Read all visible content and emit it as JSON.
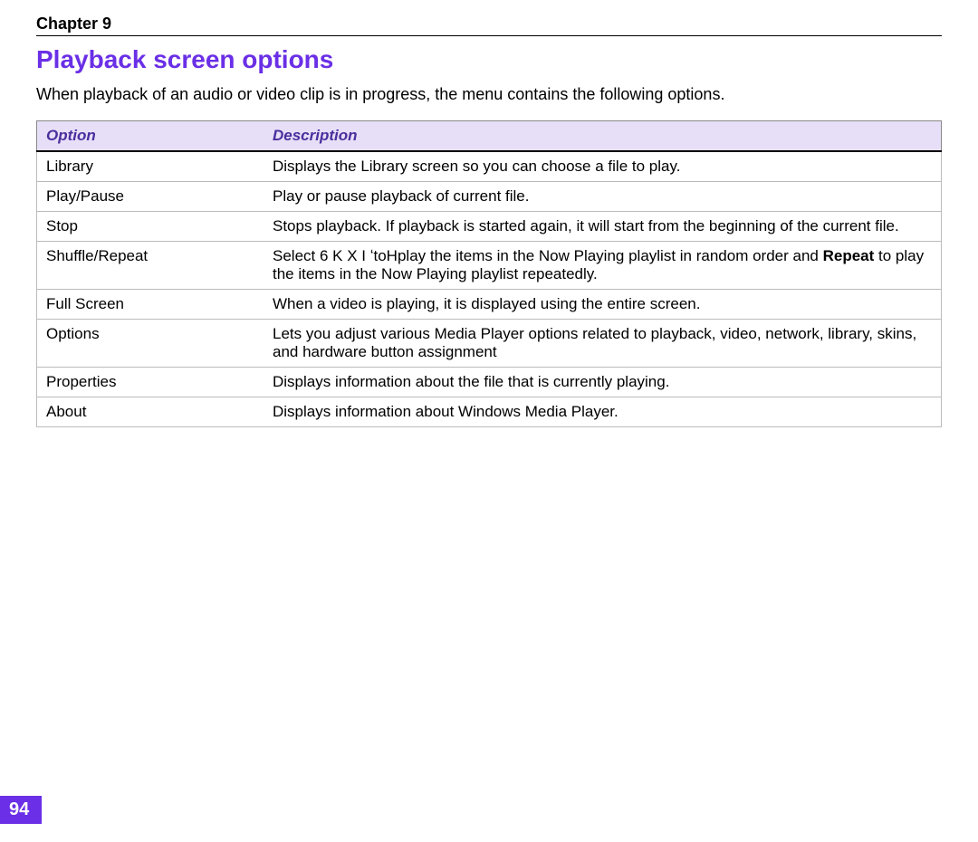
{
  "chapter": "Chapter 9",
  "section_title": "Playback screen options",
  "intro": "When playback of an audio or video clip is in progress, the menu contains the following options.",
  "columns": {
    "option": "Option",
    "description": "Description"
  },
  "rows": [
    {
      "option": "Library",
      "description": "Displays the Library screen so you can choose a file to play."
    },
    {
      "option": "Play/Pause",
      "description": "Play or pause playback of current file."
    },
    {
      "option": "Stop",
      "description": "Stops playback. If playback is started again, it will start from the beginning of the current file."
    },
    {
      "option": "Shuffle/Repeat",
      "pre": "Select ",
      "garble": "6 K X I ʻtoHplay",
      "mid": " the items in the Now Playing playlist in random order and ",
      "bold": "Repeat",
      "post": " to play the items in the Now Playing playlist repeatedly."
    },
    {
      "option": "Full Screen",
      "description": "When a video is playing, it is displayed using the entire screen."
    },
    {
      "option": "Options",
      "description": "Lets you adjust various Media Player options related to playback, video, network, library, skins, and hardware button assignment"
    },
    {
      "option": "Properties",
      "description": "Displays information about the file that is currently playing."
    },
    {
      "option": "About",
      "description": "Displays information about Windows Media Player."
    }
  ],
  "page_number": "94"
}
